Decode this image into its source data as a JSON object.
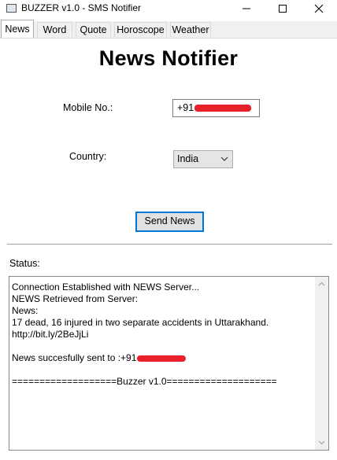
{
  "window": {
    "title": "BUZZER v1.0 - SMS Notifier"
  },
  "tabs": [
    {
      "label": "News",
      "active": true
    },
    {
      "label": "Word"
    },
    {
      "label": "Quote"
    },
    {
      "label": "Horoscope"
    },
    {
      "label": "Weather"
    }
  ],
  "main": {
    "heading": "News Notifier",
    "mobile_label": "Mobile No.:",
    "mobile_prefix": "+91",
    "country_label": "Country:",
    "country_selected": "India",
    "send_button": "Send News",
    "status_label": "Status:"
  },
  "status": {
    "lines": [
      "Connection Established with NEWS Server...",
      "NEWS Retrieved from Server:",
      "News:",
      "17 dead, 16 injured in two separate accidents in Uttarakhand.",
      "http://bit.ly/2BeJjLi",
      "",
      "News succesfully sent to :+91",
      "",
      "===================Buzzer v1.0===================="
    ]
  },
  "colors": {
    "accent": "#0078d7",
    "redaction": "#e8202a"
  }
}
